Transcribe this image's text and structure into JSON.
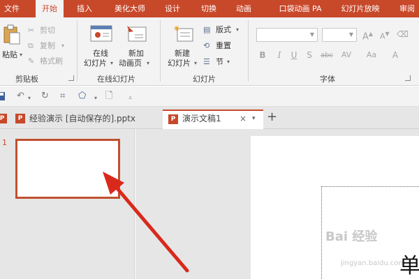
{
  "ribbon_tabs": [
    "文件",
    "开始",
    "插入",
    "美化大师",
    "设计",
    "切换",
    "动画",
    "口袋动画 PA",
    "幻灯片放映",
    "审阅"
  ],
  "ribbon": {
    "clipboard": {
      "paste_label": "粘贴",
      "cut_label": "剪切",
      "copy_label": "复制",
      "format_painter_label": "格式刷",
      "group_label": "剪贴板"
    },
    "online_slides": {
      "online_slides_label_1": "在线",
      "online_slides_label_2": "幻灯片",
      "new_animation_label_1": "新加",
      "new_animation_label_2": "动画页",
      "group_label": "在线幻灯片"
    },
    "slides": {
      "new_slide_label_1": "新建",
      "new_slide_label_2": "幻灯片",
      "layout_label": "版式",
      "reset_label": "重置",
      "section_label": "节",
      "group_label": "幻灯片"
    },
    "font": {
      "bold": "B",
      "italic": "I",
      "underline": "U",
      "shadow": "S",
      "strikethrough": "abc",
      "spacing": "AV",
      "case": "Aa",
      "color": "A",
      "group_label": "字体"
    }
  },
  "doc_tabs": {
    "tab1": "经验演示 [自动保存的].pptx",
    "tab2": "演示文稿1",
    "close_symbol": "×",
    "new_symbol": "+"
  },
  "thumbnails": {
    "slide_number": "1"
  },
  "watermark": {
    "text": "Bai 经验",
    "url": "jingyan.baidu.com"
  },
  "editor": {
    "visible_title_char": "单"
  },
  "colors": {
    "accent": "#c8482a",
    "arrow": "#d9291c"
  }
}
